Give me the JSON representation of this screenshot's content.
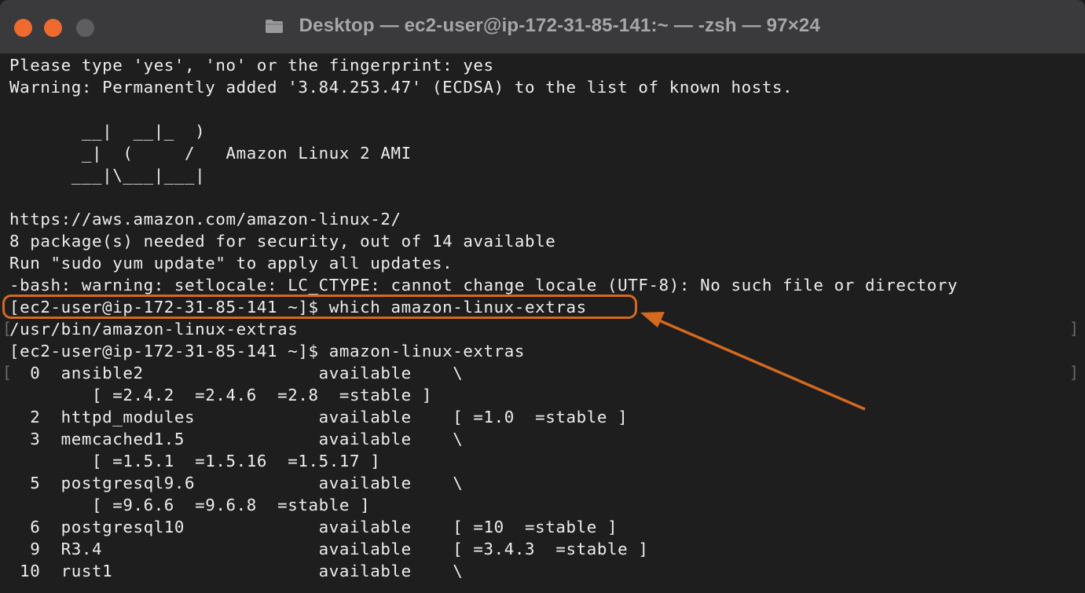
{
  "window": {
    "title": "Desktop — ec2-user@ip-172-31-85-141:~ — -zsh — 97×24",
    "buttons": {
      "close": "close",
      "minimize": "minimize",
      "zoom": "zoom"
    }
  },
  "colors": {
    "terminal_bg": "#1e1e1e",
    "text": "#ededed",
    "highlight": "#d4691f"
  },
  "terminal": {
    "lines": [
      "Please type 'yes', 'no' or the fingerprint: yes",
      "Warning: Permanently added '3.84.253.47' (ECDSA) to the list of known hosts.",
      "",
      "       __|  __|_  )",
      "       _|  (     /   Amazon Linux 2 AMI",
      "      ___|\\___|___|",
      "",
      "https://aws.amazon.com/amazon-linux-2/",
      "8 package(s) needed for security, out of 14 available",
      "Run \"sudo yum update\" to apply all updates.",
      "-bash: warning: setlocale: LC_CTYPE: cannot change locale (UTF-8): No such file or directory",
      "[ec2-user@ip-172-31-85-141 ~]$ which amazon-linux-extras",
      "/usr/bin/amazon-linux-extras",
      "[ec2-user@ip-172-31-85-141 ~]$ amazon-linux-extras",
      "  0  ansible2                 available    \\",
      "        [ =2.4.2  =2.4.6  =2.8  =stable ]",
      "  2  httpd_modules            available    [ =1.0  =stable ]",
      "  3  memcached1.5             available    \\",
      "        [ =1.5.1  =1.5.16  =1.5.17 ]",
      "  5  postgresql9.6            available    \\",
      "        [ =9.6.6  =9.6.8  =stable ]",
      "  6  postgresql10             available    [ =10  =stable ]",
      "  9  R3.4                     available    [ =3.4.3  =stable ]",
      " 10  rust1                    available    \\"
    ]
  }
}
